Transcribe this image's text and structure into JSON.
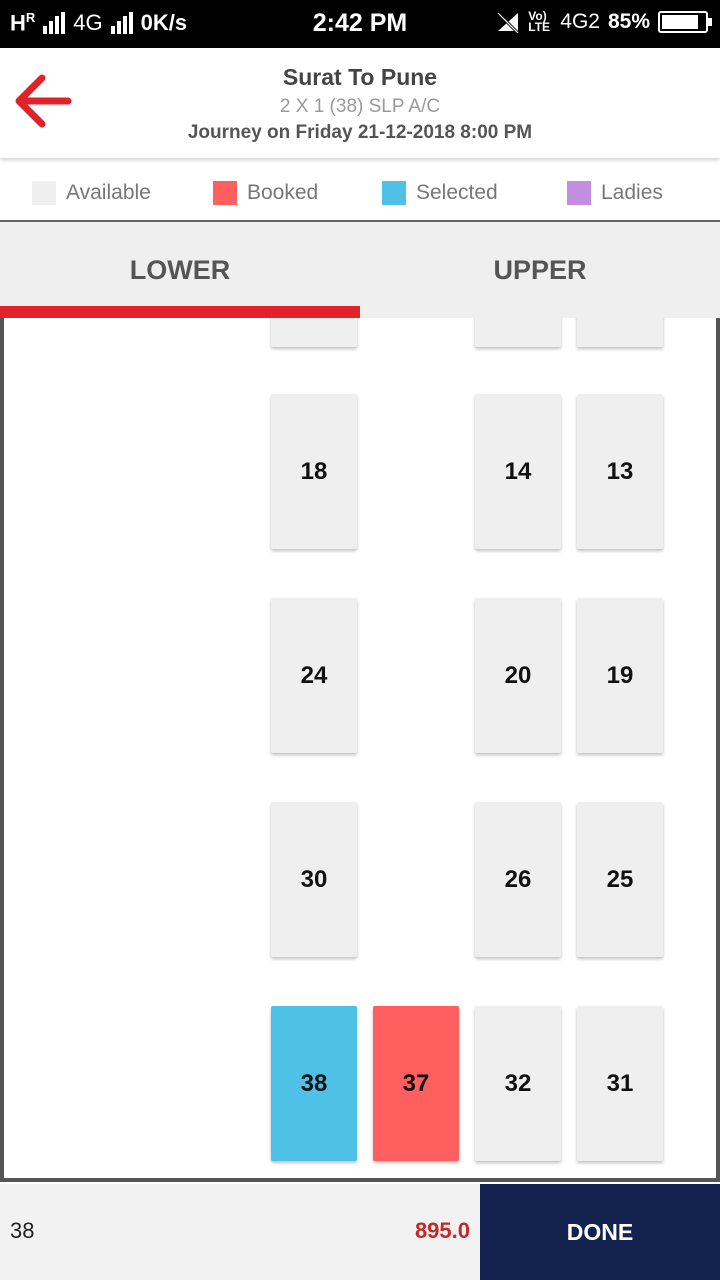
{
  "status_bar": {
    "network_left": "H",
    "roaming": "R",
    "network_type": "4G",
    "speed": "0K/s",
    "time": "2:42 PM",
    "volte": "Vo) LTE",
    "network_type_2": "4G2",
    "battery": "85%",
    "battery_level": 0.85
  },
  "header": {
    "title": "Surat To Pune",
    "subtitle": "2 X 1 (38) SLP A/C",
    "journey": "Journey on Friday 21-12-2018  8:00 PM",
    "back_icon": "arrow-left-icon"
  },
  "legend": [
    {
      "label": "Available",
      "color": "#efefef"
    },
    {
      "label": "Booked",
      "color": "#ff5f5f"
    },
    {
      "label": "Selected",
      "color": "#4fc1e6"
    },
    {
      "label": "Ladies",
      "color": "#c48ee0"
    }
  ],
  "tabs": {
    "lower": "LOWER",
    "upper": "UPPER",
    "active": "lower"
  },
  "seats": {
    "s18": "18",
    "s14": "14",
    "s13": "13",
    "s24": "24",
    "s20": "20",
    "s19": "19",
    "s30": "30",
    "s26": "26",
    "s25": "25",
    "s38": "38",
    "s37": "37",
    "s32": "32",
    "s31": "31"
  },
  "seat_status": {
    "38": "selected",
    "37": "booked"
  },
  "footer": {
    "selected_seat": "38",
    "price": "895.0",
    "done_label": "DONE"
  },
  "colors": {
    "accent_red": "#e0222a",
    "booked": "#ff5f5f",
    "selected": "#4fc1e6",
    "done_bg": "#14224f"
  }
}
